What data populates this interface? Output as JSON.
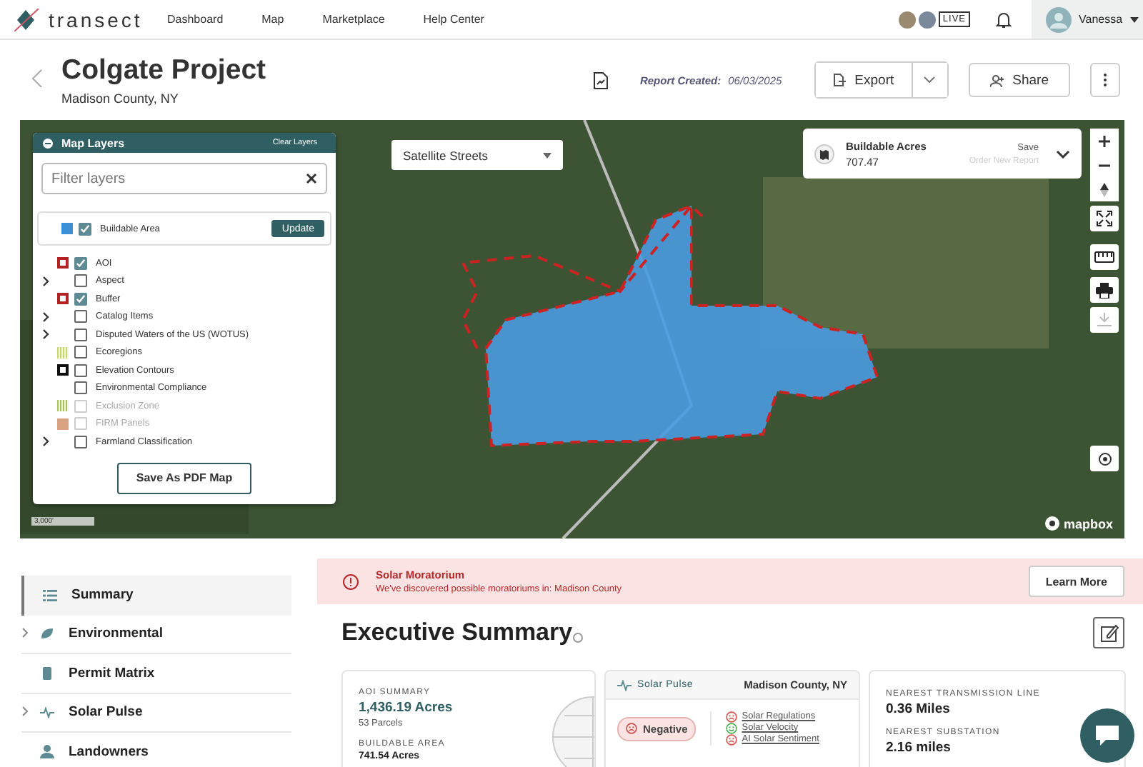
{
  "header": {
    "logo": "transect",
    "nav": [
      {
        "label": "Dashboard"
      },
      {
        "label": "Map"
      },
      {
        "label": "Marketplace"
      },
      {
        "label": "Help Center"
      }
    ],
    "live_badge": "LIVE",
    "user": "Vanessa"
  },
  "project": {
    "title": "Colgate Project",
    "subtitle": "Madison County, NY",
    "report_label": "Report Created:",
    "report_date": "06/03/2025",
    "export": "Export",
    "share": "Share"
  },
  "map": {
    "style_select": "Satellite Streets",
    "scale": "3,000'",
    "attribution": "mapbox",
    "acres_card": {
      "title": "Buildable Acres",
      "value": "707.47",
      "save": "Save",
      "order": "Order New Report"
    },
    "layers_panel": {
      "title": "Map Layers",
      "clear": "Clear Layers",
      "filter_placeholder": "Filter layers",
      "update": "Update",
      "save_pdf": "Save As PDF Map",
      "layers": [
        {
          "label": "Buildable Area",
          "kind": "fill",
          "color": "#3b8fd6",
          "checked": true,
          "expandable": false,
          "disabled": false,
          "featured": true
        },
        {
          "label": "AOI",
          "kind": "outline",
          "color": "#b22222",
          "checked": true,
          "expandable": false,
          "disabled": false,
          "featured": false
        },
        {
          "label": "Aspect",
          "kind": "none",
          "checked": false,
          "expandable": true,
          "disabled": false,
          "featured": false
        },
        {
          "label": "Buffer",
          "kind": "dashed",
          "color": "#b22222",
          "checked": true,
          "expandable": false,
          "disabled": false,
          "featured": false
        },
        {
          "label": "Catalog Items",
          "kind": "none",
          "checked": false,
          "expandable": true,
          "disabled": false,
          "featured": false
        },
        {
          "label": "Disputed Waters of the US (WOTUS)",
          "kind": "none",
          "checked": false,
          "expandable": true,
          "disabled": false,
          "featured": false
        },
        {
          "label": "Ecoregions",
          "kind": "pattern",
          "color": "#c9d66b",
          "checked": false,
          "expandable": false,
          "disabled": false,
          "featured": false
        },
        {
          "label": "Elevation Contours",
          "kind": "outline",
          "color": "#111111",
          "checked": false,
          "expandable": false,
          "disabled": false,
          "featured": false
        },
        {
          "label": "Environmental Compliance",
          "kind": "none",
          "checked": false,
          "expandable": false,
          "disabled": false,
          "featured": false
        },
        {
          "label": "Exclusion Zone",
          "kind": "pattern",
          "color": "#a9c25a",
          "checked": false,
          "expandable": false,
          "disabled": true,
          "featured": false
        },
        {
          "label": "FIRM Panels",
          "kind": "fill",
          "color": "#d9a283",
          "checked": false,
          "expandable": false,
          "disabled": true,
          "featured": false
        },
        {
          "label": "Farmland Classification",
          "kind": "none",
          "checked": false,
          "expandable": true,
          "disabled": false,
          "featured": false
        }
      ]
    }
  },
  "sidebar": {
    "items": [
      {
        "label": "Summary",
        "selected": true,
        "expandable": false
      },
      {
        "label": "Environmental",
        "selected": false,
        "expandable": true
      },
      {
        "label": "Permit Matrix",
        "selected": false,
        "expandable": false
      },
      {
        "label": "Solar Pulse",
        "selected": false,
        "expandable": true
      },
      {
        "label": "Landowners",
        "selected": false,
        "expandable": false
      }
    ]
  },
  "alert": {
    "title": "Solar Moratorium",
    "message": "We've discovered possible moratoriums in: Madison County",
    "action": "Learn More"
  },
  "summary": {
    "heading": "Executive Summary",
    "aoi_card": {
      "label_1": "AOI SUMMARY",
      "value_1": "1,436.19 Acres",
      "sub_1": "53 Parcels",
      "label_2": "BUILDABLE AREA",
      "value_2": "741.54 Acres"
    },
    "pulse_card": {
      "title": "Solar Pulse",
      "location": "Madison County, NY",
      "sentiment": "Negative",
      "links": [
        {
          "label": "Solar Regulations",
          "kind": "negative",
          "color": "#d9534f"
        },
        {
          "label": "Solar Velocity",
          "kind": "positive",
          "color": "#4caf50"
        },
        {
          "label": "AI Solar Sentiment",
          "kind": "negative",
          "color": "#d9534f"
        }
      ]
    },
    "distance_card": {
      "label_1": "NEAREST TRANSMISSION LINE",
      "value_1": "0.36 Miles",
      "label_2": "NEAREST SUBSTATION",
      "value_2": "2.16 miles"
    }
  }
}
